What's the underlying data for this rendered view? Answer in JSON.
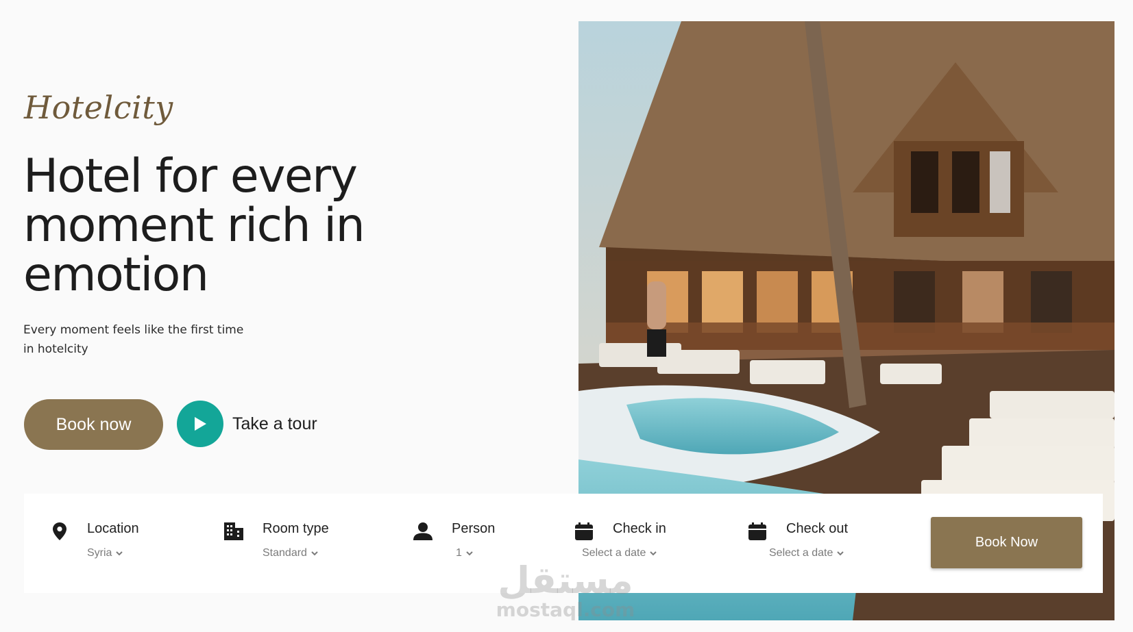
{
  "brand": {
    "logo_text": "Hotelcity",
    "primary_color": "#8a7551",
    "accent_color": "#13a698"
  },
  "hero": {
    "headline_lines": [
      "Hotel for every",
      "moment rich in",
      "emotion"
    ],
    "subtext_lines": [
      "Every moment feels like the first time",
      "in hotelcity"
    ],
    "book_now_label": "Book now",
    "tour_label": "Take a tour"
  },
  "booking": {
    "location": {
      "label": "Location",
      "value": "Syria",
      "icon": "location-pin-icon"
    },
    "room_type": {
      "label": "Room type",
      "value": "Standard",
      "icon": "building-icon"
    },
    "person": {
      "label": "Person",
      "value": "1",
      "icon": "person-icon"
    },
    "check_in": {
      "label": "Check in",
      "value": "Select a date",
      "icon": "calendar-icon"
    },
    "check_out": {
      "label": "Check out",
      "value": "Select a date",
      "icon": "calendar-icon"
    },
    "submit_label": "Book Now"
  },
  "watermark": {
    "arabic": "مستقل",
    "latin": "mostaql.com"
  }
}
